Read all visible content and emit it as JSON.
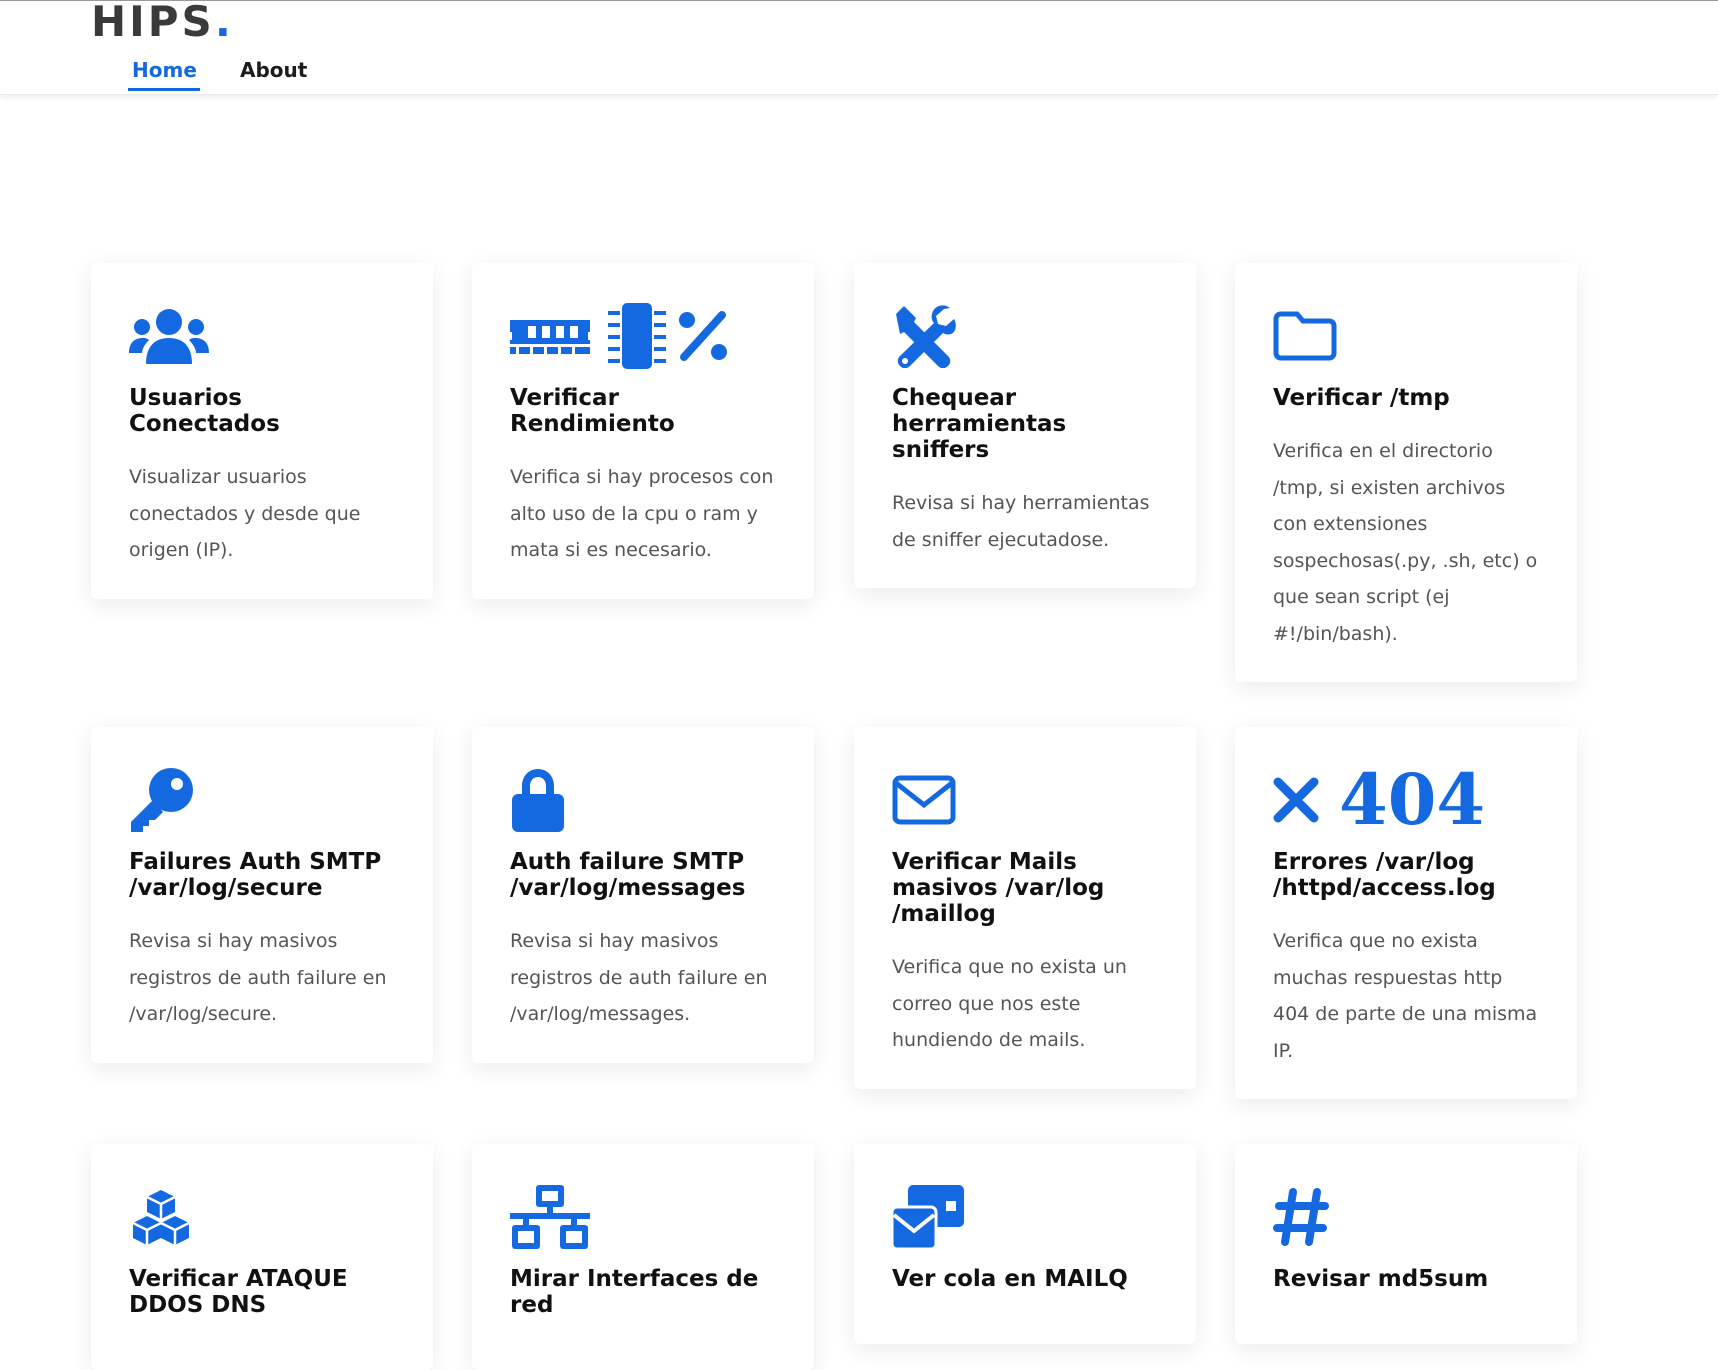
{
  "header": {
    "logo_text": "HIPS",
    "logo_dot": ".",
    "nav": [
      {
        "label": "Home",
        "active": true
      },
      {
        "label": "About",
        "active": false
      }
    ]
  },
  "colors": {
    "accent": "#1569e0",
    "heading": "#111111",
    "body_text": "#555555"
  },
  "cards": [
    {
      "icon": "users-icon",
      "title": "Usuarios Conectados",
      "description": "Visualizar usuarios conectados y desde que origen (IP)."
    },
    {
      "icon": "memory-microchip-percent-icons",
      "title": "Verificar Rendimiento",
      "description": "Verifica si hay procesos con alto uso de la cpu o ram y mata si es necesario."
    },
    {
      "icon": "tools-icon",
      "title": "Chequear herramientas sniffers",
      "description": "Revisa si hay herramientas de sniffer ejecutadose."
    },
    {
      "icon": "folder-icon",
      "title": "Verificar /tmp",
      "description": "Verifica en el directorio /tmp, si existen archivos con extensiones sospechosas(.py, .sh, etc) o que sean script (ej #!/bin/bash)."
    },
    {
      "icon": "key-icon",
      "title": "Failures Auth SMTP /var/log/secure",
      "description": "Revisa si hay masivos registros de auth failure en /var/log/secure."
    },
    {
      "icon": "lock-icon",
      "title": "Auth failure SMTP /var/log/messages",
      "description": "Revisa si hay masivos registros de auth failure en /var/log/messages."
    },
    {
      "icon": "envelope-icon",
      "title": "Verificar Mails masivos /var/log /maillog",
      "description": "Verifica que no exista un correo que nos este hundiendo de mails."
    },
    {
      "icon": "times-icon",
      "icon_text": "404",
      "title": "Errores /var/log /httpd/access.log",
      "description": "Verifica que no exista muchas respuestas http 404 de parte de una misma IP."
    },
    {
      "icon": "cubes-icon",
      "title": "Verificar ATAQUE DDOS DNS",
      "description": ""
    },
    {
      "icon": "network-icon",
      "title": "Mirar Interfaces de red",
      "description": ""
    },
    {
      "icon": "mail-bulk-icon",
      "title": "Ver cola en MAILQ",
      "description": ""
    },
    {
      "icon": "hashtag-icon",
      "title": "Revisar md5sum",
      "description": ""
    }
  ]
}
